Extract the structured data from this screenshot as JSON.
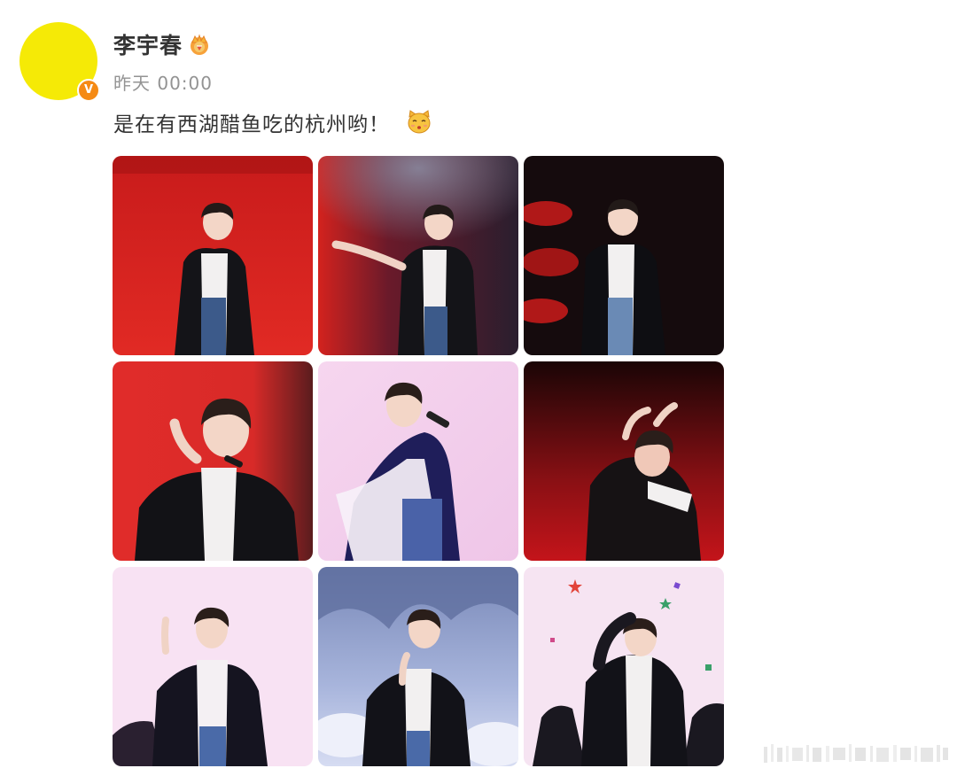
{
  "post": {
    "author": {
      "name": "李宇春",
      "avatar_color": "#f5ea06",
      "verified_badge": "V",
      "badge_color": "#f58a15",
      "vip_icon": "crown-icon"
    },
    "timestamp": "昨天 00:00",
    "text": "是在有西湖醋鱼吃的杭州哟！",
    "emoji": "kissing-cat-emoji",
    "photos": [
      {
        "theme": "red-stage"
      },
      {
        "theme": "red-smoke-stage"
      },
      {
        "theme": "dark-stage-red-flowers"
      },
      {
        "theme": "red-stage-closeup"
      },
      {
        "theme": "pink-stage"
      },
      {
        "theme": "dark-red-stage"
      },
      {
        "theme": "pink-stage-dancers"
      },
      {
        "theme": "blue-ice-stage"
      },
      {
        "theme": "pink-stage-confetti"
      }
    ]
  }
}
